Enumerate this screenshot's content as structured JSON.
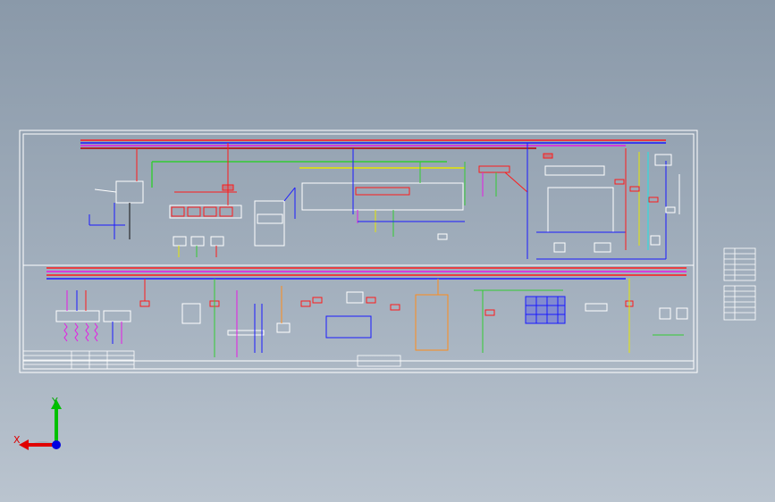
{
  "view": {
    "background_top": "#8a99a9",
    "background_bottom": "#bac4cf",
    "sheet_line_color": "#ffffff"
  },
  "wire_colors": {
    "red": "#ff1a1a",
    "green": "#33cc33",
    "blue": "#1a1aff",
    "yellow": "#e6e600",
    "magenta": "#e61ae6",
    "cyan": "#1ae6e6",
    "orange": "#ff8c1a",
    "dark_red": "#b30000",
    "black": "#111111",
    "white": "#ffffff"
  },
  "triad": {
    "x_label": "X",
    "y_label": "Y",
    "x_color": "#e00000",
    "y_color": "#00c000",
    "z_color": "#0000e0",
    "icon": "coordinate-triad-icon"
  }
}
